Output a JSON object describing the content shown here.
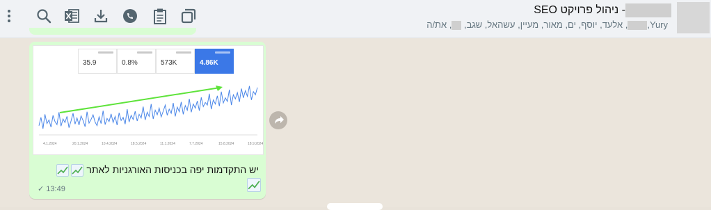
{
  "header": {
    "title_suffix": "- ניהול פרויקט SEO",
    "members_start": "Yury,",
    "members_rest": ", אלעד, יוסף, ים, מאור, מעיין, עשהאל, שגב, ",
    "members_end": ", את/ה"
  },
  "toolbar": {
    "icons": [
      "menu-dots-icon",
      "search-icon",
      "excel-icon",
      "download-icon",
      "whatsapp-icon",
      "clipboard-icon",
      "window-icon"
    ]
  },
  "message": {
    "stats": [
      {
        "label_icon": "info-icon",
        "value": "4.86K",
        "highlight": true
      },
      {
        "label_icon": "info-icon",
        "value": "573K",
        "highlight": false
      },
      {
        "label_icon": "info-icon",
        "value": "0.8%",
        "highlight": false
      },
      {
        "label_icon": "info-icon",
        "value": "35.9",
        "highlight": false
      }
    ],
    "caption": "יש התקדמות יפה בכניסות האורגניות לאתר",
    "time": "13:49"
  },
  "chart_data": {
    "type": "line",
    "series": [
      {
        "values": [
          18,
          34,
          12,
          40,
          22,
          29,
          15,
          38,
          26,
          20,
          44,
          17,
          31,
          24,
          36,
          14,
          27,
          42,
          21,
          33,
          19,
          37,
          28,
          16,
          45,
          23,
          30,
          39,
          25,
          18,
          35,
          22,
          47,
          20,
          32,
          26,
          41,
          24,
          36,
          19,
          43,
          28,
          34,
          21,
          50,
          25,
          38,
          30,
          46,
          27,
          40,
          33,
          55,
          29,
          44,
          36,
          60,
          31,
          48,
          39,
          52,
          35,
          46,
          58,
          38,
          50,
          42,
          62,
          36,
          54,
          45,
          64,
          40,
          57,
          48,
          70,
          44,
          60,
          52,
          66,
          47,
          73,
          55,
          63,
          58,
          80,
          50,
          68,
          60,
          76,
          56,
          84,
          62,
          72,
          65,
          88,
          58,
          78,
          70,
          82,
          64,
          90,
          72,
          86,
          75,
          95,
          68,
          84,
          78,
          92
        ]
      }
    ],
    "x_ticks": [
      "4.1.2024",
      "20.1.2024",
      "10.4.2024",
      "18.5.2024",
      "11.1.2024",
      "7.7.2024",
      "15.8.2024",
      "18.9.2024"
    ],
    "trend_arrow": "up"
  }
}
